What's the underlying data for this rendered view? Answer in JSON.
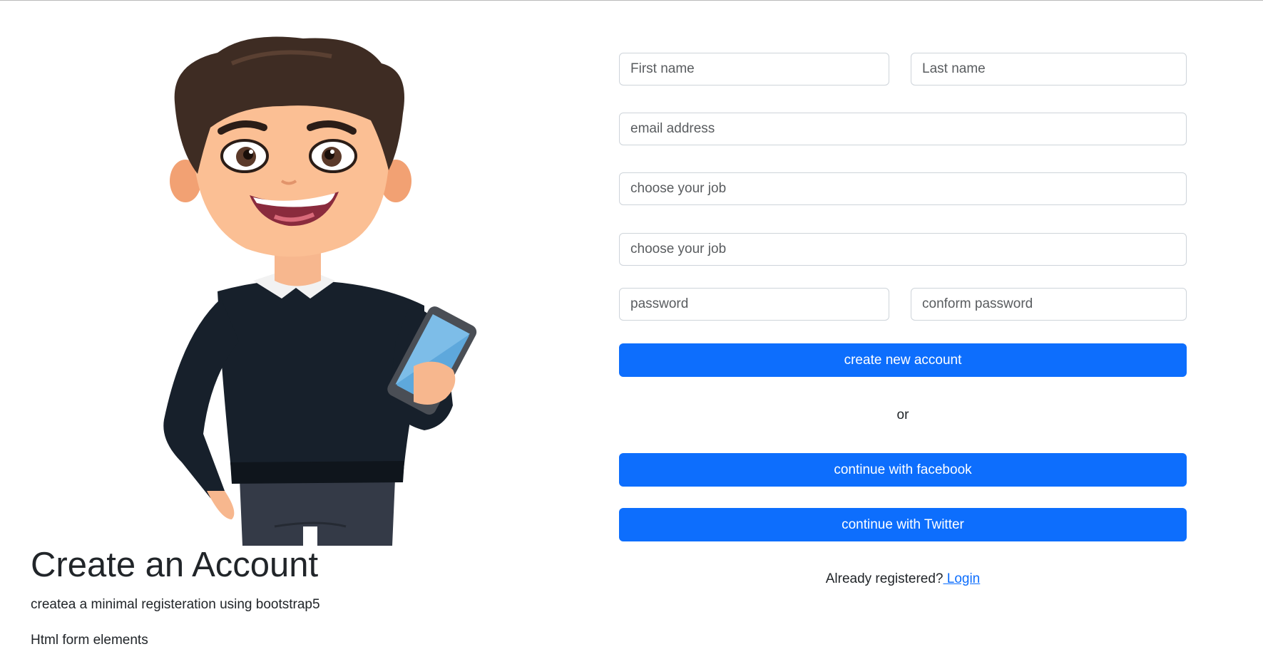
{
  "hero": {
    "title": "Create an Account",
    "subtitle": "createa a minimal registeration using bootstrap5",
    "note": "Html form elements",
    "illustration": "cartoon-man-holding-phone"
  },
  "form": {
    "first_name": {
      "placeholder": "First name",
      "value": ""
    },
    "last_name": {
      "placeholder": "Last name",
      "value": ""
    },
    "email": {
      "placeholder": "email address",
      "value": ""
    },
    "job_1": {
      "placeholder": "choose your job",
      "value": ""
    },
    "job_2": {
      "placeholder": "choose your job",
      "value": ""
    },
    "password": {
      "placeholder": "password",
      "value": ""
    },
    "confirm_password": {
      "placeholder": "conform password",
      "value": ""
    },
    "create_button": "create new account",
    "or_text": "or",
    "facebook_button": "continue with facebook",
    "twitter_button": "continue with Twitter",
    "already_registered": "Already registered?",
    "login_link": " Login"
  },
  "colors": {
    "primary": "#0d6efd",
    "input_border": "#ced4da",
    "text": "#212529"
  }
}
